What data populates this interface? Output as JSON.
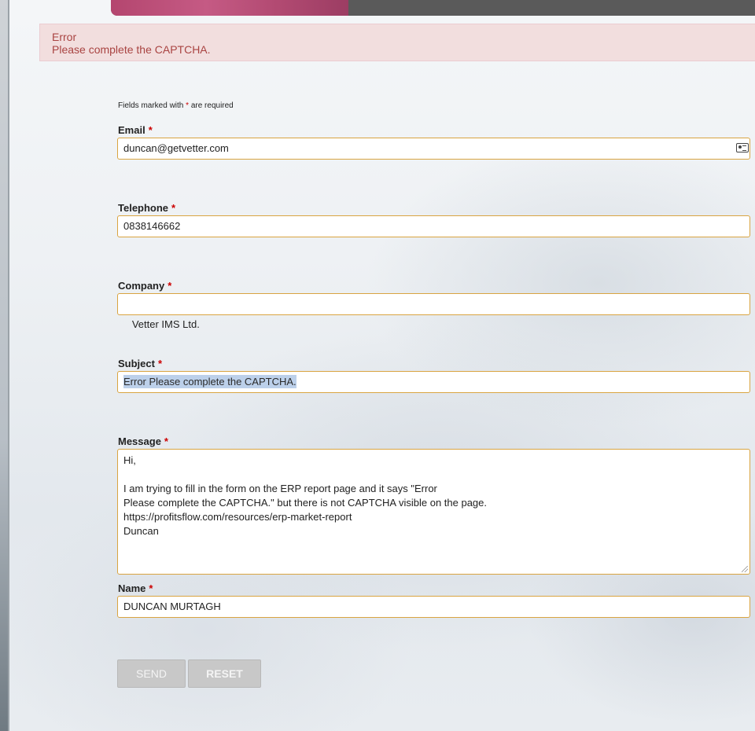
{
  "alert": {
    "title": "Error",
    "message": "Please complete the CAPTCHA."
  },
  "form": {
    "required_note_prefix": "Fields marked with ",
    "required_star": "*",
    "required_note_suffix": " are required",
    "email": {
      "label": "Email",
      "value": "duncan@getvetter.com"
    },
    "telephone": {
      "label": "Telephone",
      "value": "0838146662"
    },
    "company": {
      "label": "Company",
      "value": " Vetter IMS Ltd."
    },
    "subject": {
      "label": "Subject",
      "value": "Error Please complete the CAPTCHA."
    },
    "message": {
      "label": "Message",
      "value": "Hi,\n\nI am trying to fill in the form on the ERP report page and it says \"Error\nPlease complete the CAPTCHA.\" but there is not CAPTCHA visible on the page.\nhttps://profitsflow.com/resources/erp-market-report\nDuncan"
    },
    "name": {
      "label": "Name",
      "value": "DUNCAN MURTAGH"
    },
    "send_label": "SEND",
    "reset_label": "RESET"
  },
  "colors": {
    "input_border": "#d9a441",
    "required": "#cc0000",
    "alert_bg": "#f2dede",
    "alert_text": "#a94442",
    "selection": "#bcd0ea"
  },
  "icons": {
    "email_autofill": "contact-card-icon"
  }
}
